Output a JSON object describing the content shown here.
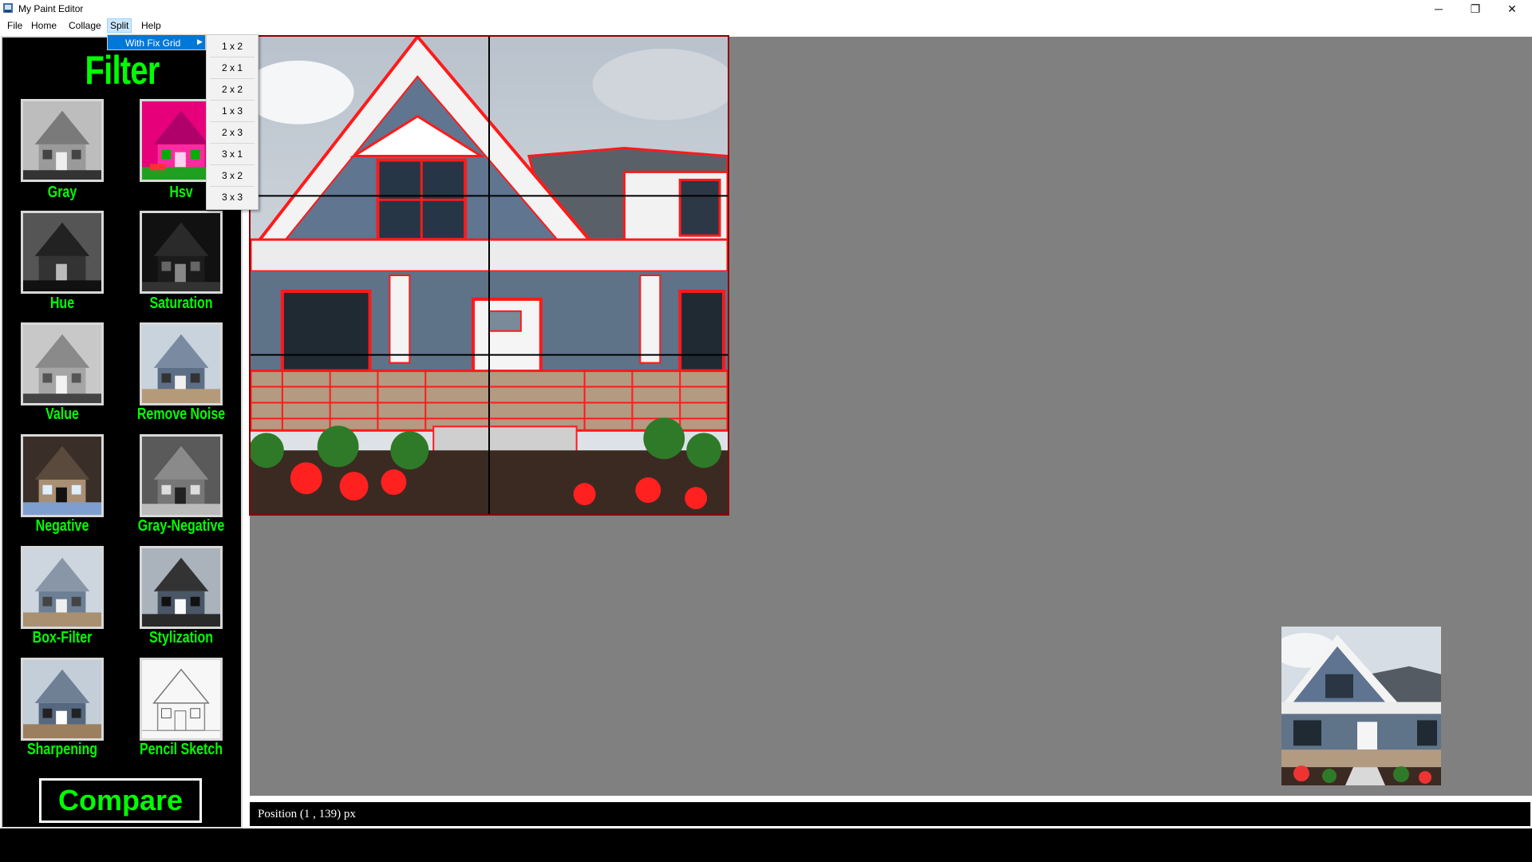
{
  "window": {
    "title": "My Paint Editor",
    "controls": [
      "─",
      "❐",
      "✕"
    ]
  },
  "menu": [
    "File",
    "Home",
    "Collage",
    "Split",
    "Help"
  ],
  "split_menu": {
    "item": "With Fix Grid",
    "arrow": "▶",
    "submenu": [
      "1 x 2",
      "2 x 1",
      "2 x 2",
      "1 x 3",
      "2 x 3",
      "3 x 1",
      "3 x 2",
      "3 x 3"
    ]
  },
  "sidebar": {
    "title": "Filter",
    "filters": [
      "Gray",
      "Hsv",
      "Hue",
      "Saturation",
      "Value",
      "Remove Noise",
      "Negative",
      "Gray-Negative",
      "Box-Filter",
      "Stylization",
      "Sharpening",
      "Pencil Sketch"
    ],
    "compare_label": "Compare"
  },
  "status": {
    "position_text": "Position (1 , 139) px"
  },
  "colors": {
    "accent_green": "#00ff00",
    "menu_highlight": "#0078d7",
    "canvas_bg": "#808080",
    "edge_red": "#ff1a1a"
  }
}
